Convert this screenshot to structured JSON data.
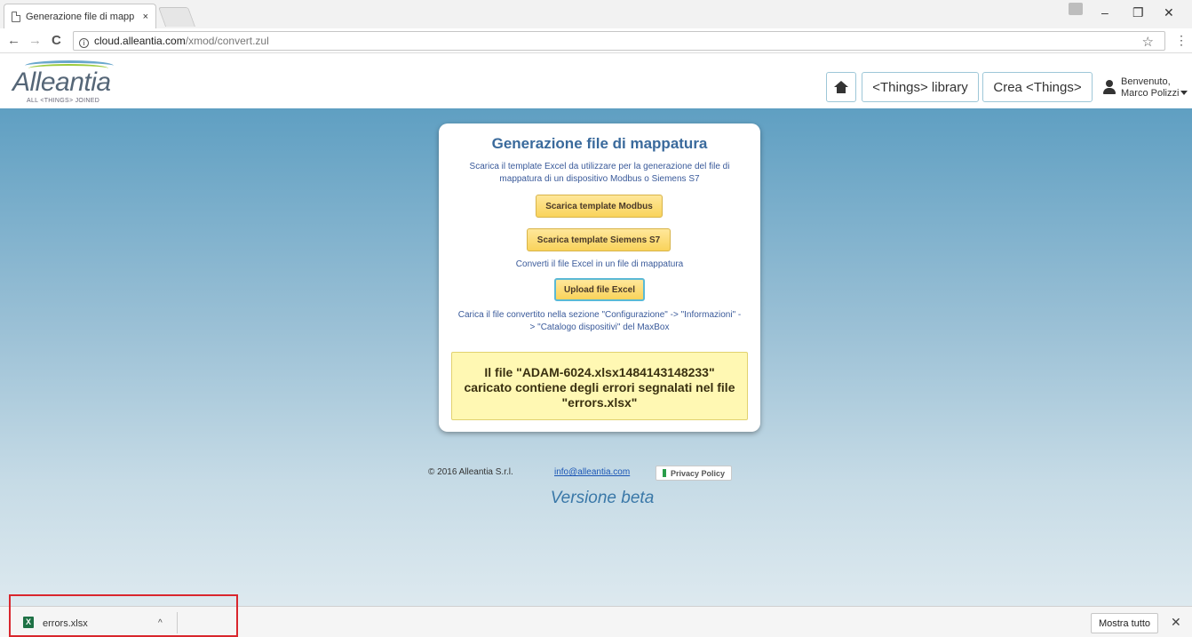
{
  "browser": {
    "tab_title": "Generazione file di mapp",
    "tab_close": "×",
    "url_host": "cloud.alleantia.com",
    "url_path": "/xmod/convert.zul",
    "info_glyph": "i",
    "back": "←",
    "forward": "→",
    "reload": "C",
    "star": "☆",
    "menu": "⋮",
    "minimize": "–",
    "restore": "❐",
    "close": "✕"
  },
  "header": {
    "logo_word": "Alleantia",
    "logo_tagline": "ALL <THINGS> JOINED",
    "library_label": "<Things> library",
    "create_label": "Crea <Things>",
    "welcome": "Benvenuto,",
    "user_name": "Marco Polizzi"
  },
  "card": {
    "title": "Generazione file di mappatura",
    "intro": "Scarica il template Excel da utilizzare per la generazione del file di mappatura di un dispositivo Modbus o Siemens S7",
    "modbus_button": "Scarica template Modbus",
    "siemens_button": "Scarica template Siemens S7",
    "convert_text": "Converti il file Excel in un file di mappatura",
    "upload_button": "Upload file Excel",
    "instructions": "Carica il file convertito nella sezione \"Configurazione\" -> \"Informazioni\" -> \"Catalogo dispositivi\" del MaxBox",
    "error_message": "Il file \"ADAM-6024.xlsx1484143148233\" caricato contiene degli errori segnalati nel file \"errors.xlsx\""
  },
  "footer": {
    "copyright": "© 2016 Alleantia S.r.l.",
    "email": "info@alleantia.com",
    "privacy": "Privacy Policy",
    "beta": "Versione beta"
  },
  "downloads": {
    "file_name": "errors.xlsx",
    "file_glyph": "X",
    "chevron": "^",
    "show_all": "Mostra tutto",
    "close": "✕"
  },
  "colors": {
    "accent_blue": "#3a6a9c",
    "button_yellow": "#f9d35b",
    "alert_bg": "#fff8b3",
    "highlight_red": "#d9262d"
  },
  "icons": [
    "document-icon",
    "info-icon",
    "star-icon",
    "home-icon",
    "user-icon",
    "excel-file-icon",
    "lock-icon",
    "chevron-up-icon",
    "close-icon"
  ]
}
